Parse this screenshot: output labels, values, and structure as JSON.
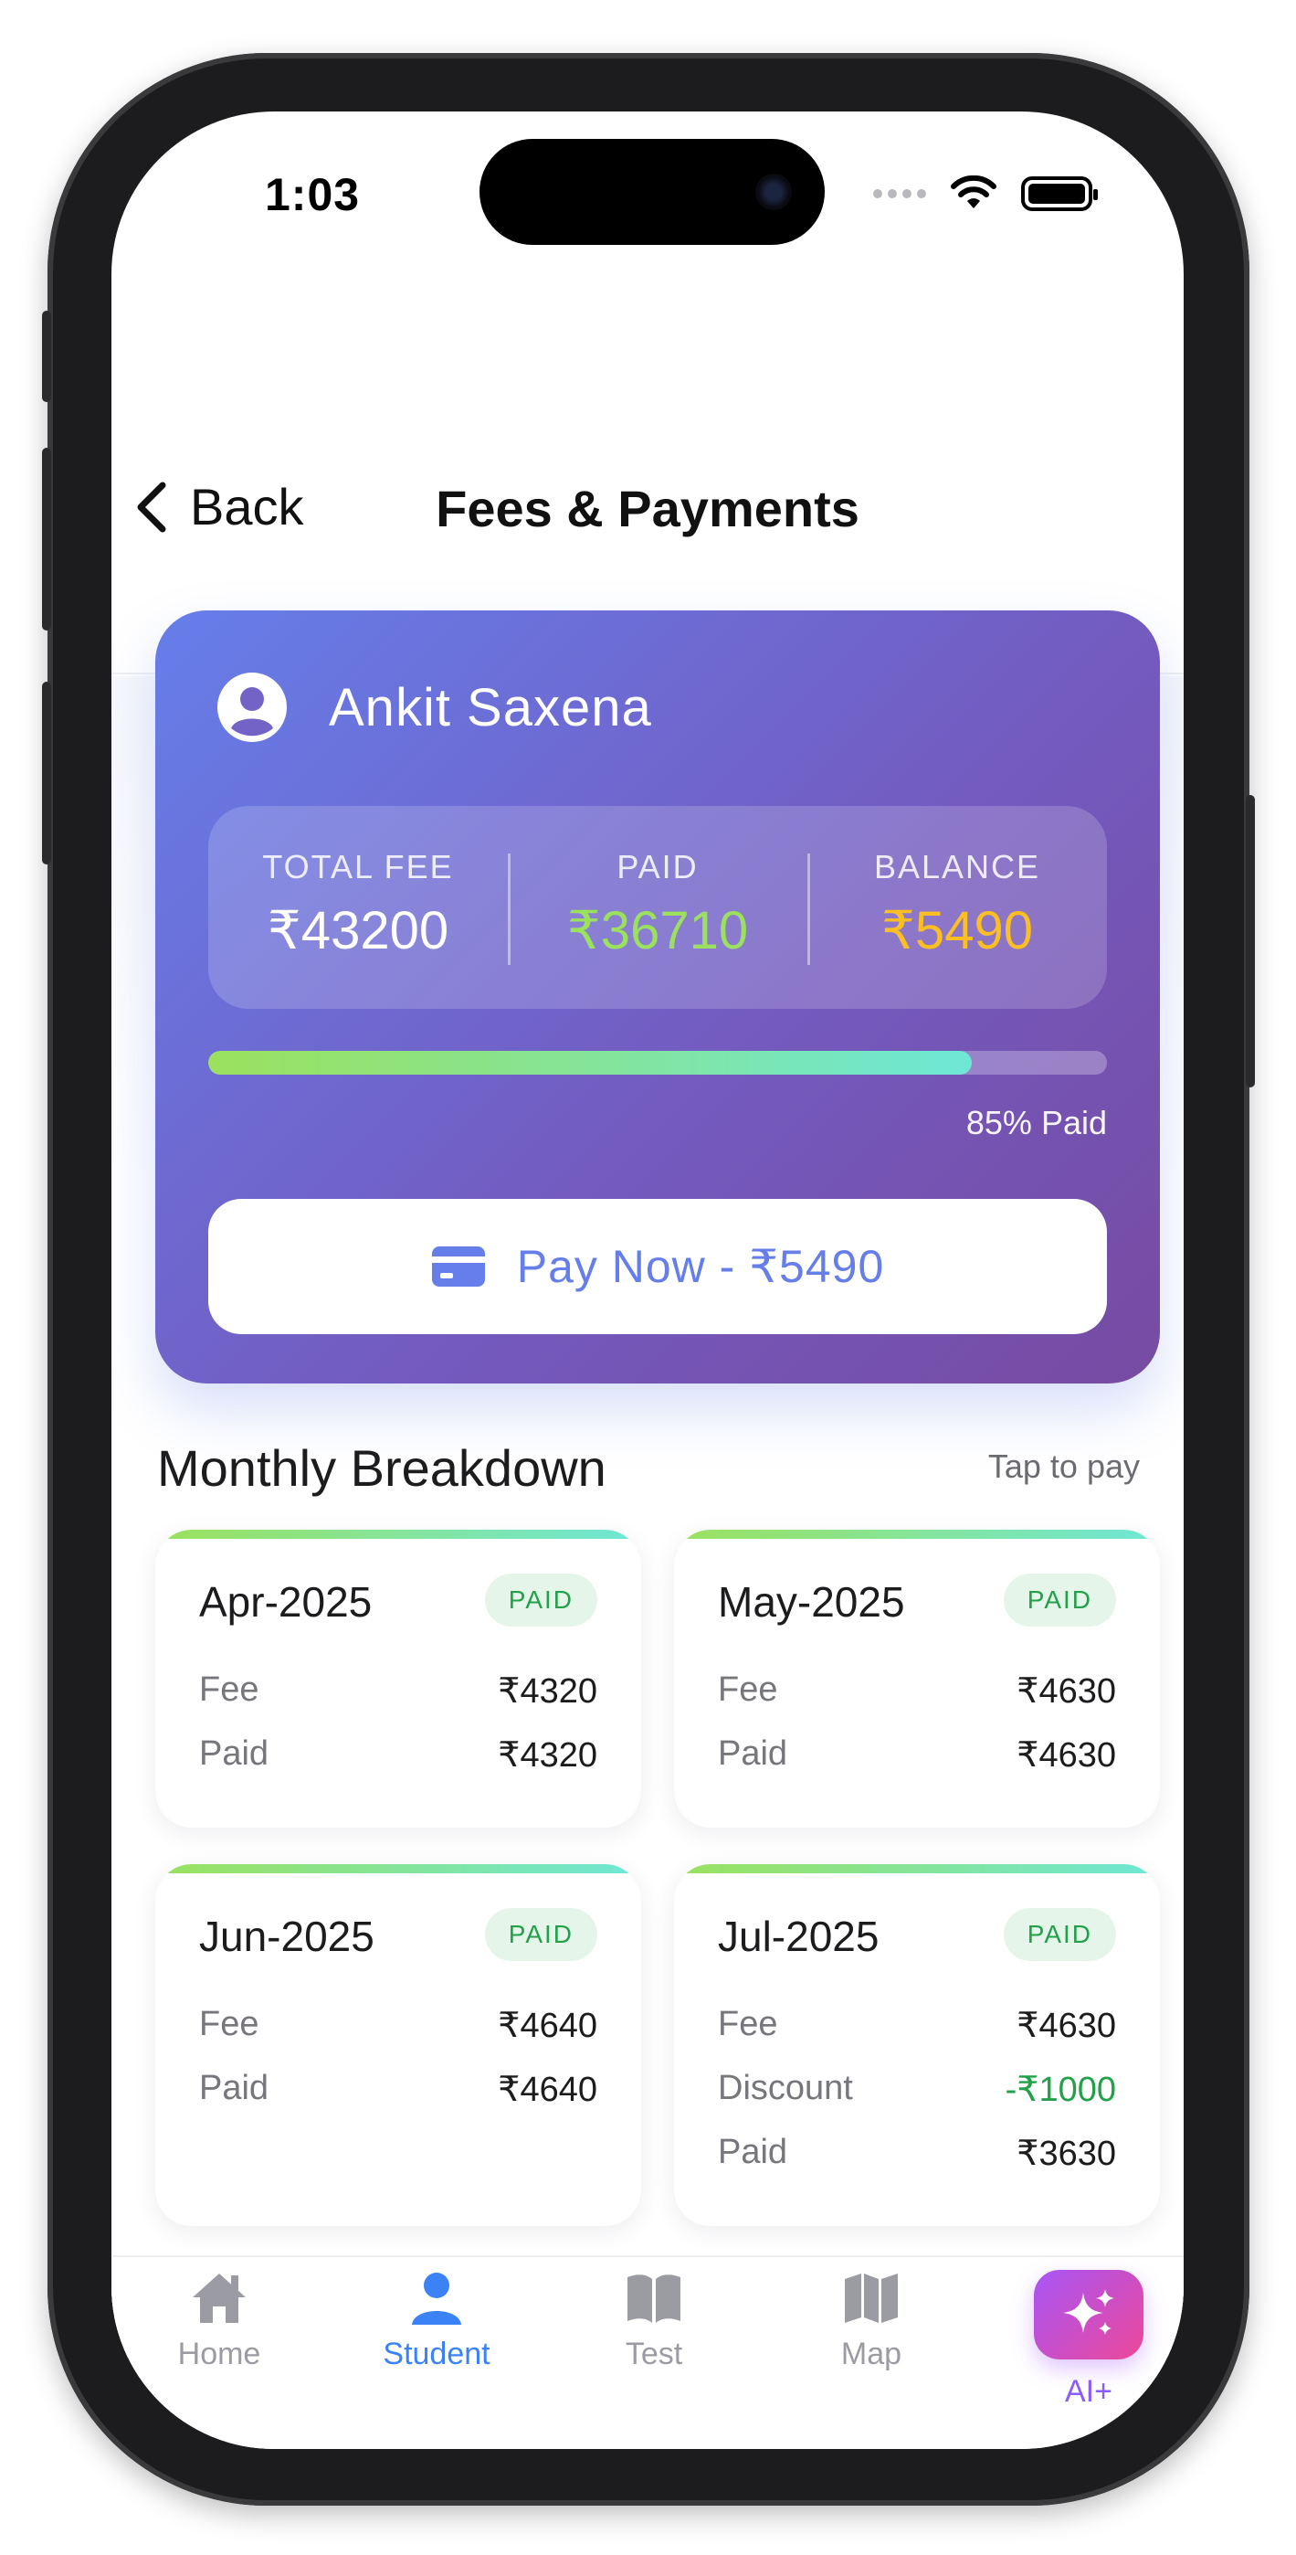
{
  "status_bar": {
    "time": "1:03"
  },
  "header": {
    "back_label": "Back",
    "title": "Fees & Payments"
  },
  "summary": {
    "student_name": "Ankit Saxena",
    "total_fee_label": "TOTAL FEE",
    "total_fee_value": "₹43200",
    "paid_label": "PAID",
    "paid_value": "₹36710",
    "balance_label": "BALANCE",
    "balance_value": "₹5490",
    "progress_fraction": 0.85,
    "progress_text": "85% Paid",
    "pay_button_label": "Pay Now - ₹5490"
  },
  "breakdown": {
    "title": "Monthly Breakdown",
    "hint": "Tap to pay",
    "months": [
      {
        "name": "Apr-2025",
        "status": "PAID",
        "fee_label": "Fee",
        "fee": "₹4320",
        "paid_label": "Paid",
        "paid": "₹4320"
      },
      {
        "name": "May-2025",
        "status": "PAID",
        "fee_label": "Fee",
        "fee": "₹4630",
        "paid_label": "Paid",
        "paid": "₹4630"
      },
      {
        "name": "Jun-2025",
        "status": "PAID",
        "fee_label": "Fee",
        "fee": "₹4640",
        "paid_label": "Paid",
        "paid": "₹4640"
      },
      {
        "name": "Jul-2025",
        "status": "PAID",
        "fee_label": "Fee",
        "fee": "₹4630",
        "discount_label": "Discount",
        "discount": "-₹1000",
        "paid_label": "Paid",
        "paid": "₹3630"
      }
    ]
  },
  "nav": {
    "home": "Home",
    "student": "Student",
    "test": "Test",
    "map": "Map",
    "ai": "AI+",
    "active": "student"
  },
  "colors": {
    "accent": "#667eea",
    "paid_green": "#9be15d",
    "balance_orange": "#fbbf24",
    "active_nav": "#3b82f6",
    "ai_gradient_start": "#a855f7",
    "ai_gradient_end": "#ec4899"
  },
  "icons": {
    "back": "chevron-left-icon",
    "avatar": "user-circle-icon",
    "pay": "credit-card-icon",
    "home": "home-icon",
    "student": "person-icon",
    "test": "book-icon",
    "map": "map-icon",
    "ai": "sparkles-icon"
  }
}
